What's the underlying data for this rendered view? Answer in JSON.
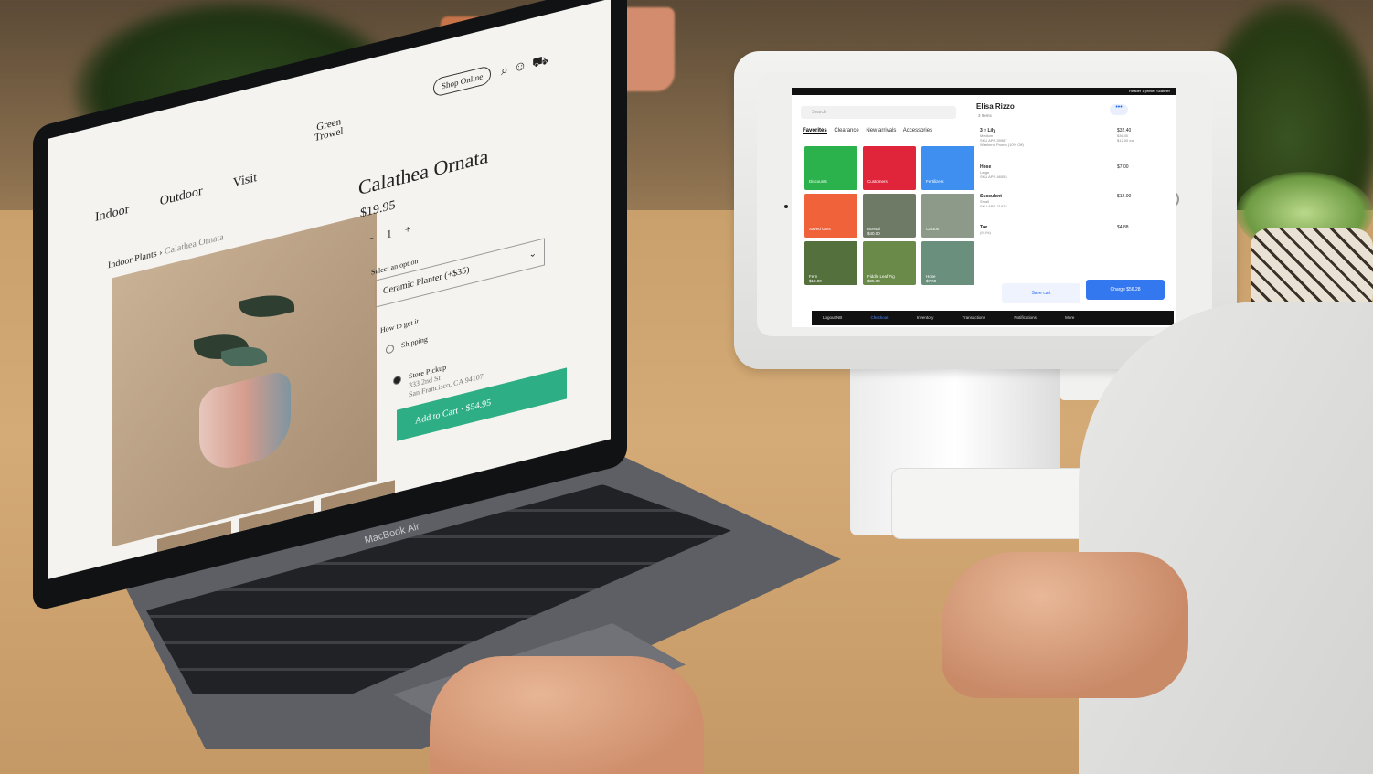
{
  "laptop": {
    "brand": "MacBook Air",
    "nav": [
      "Indoor",
      "Outdoor",
      "Visit"
    ],
    "logo": [
      "Green",
      "Trowel"
    ],
    "shop_button": "Shop Online",
    "icons": [
      "search-icon",
      "account-icon",
      "cart-icon"
    ],
    "breadcrumb": {
      "parent": "Indoor Plants",
      "current": "Calathea Ornata"
    },
    "product": {
      "title": "Calathea Ornata",
      "price": "$19.95",
      "qty_minus": "−",
      "qty_value": "1",
      "qty_plus": "+",
      "option_label": "Select an option",
      "option_value": "Ceramic Planter (+$35)",
      "get_label": "How to get it",
      "shipping": "Shipping",
      "pickup_title": "Store Pickup",
      "pickup_line1": "333 2nd St",
      "pickup_line2": "San Francisco, CA 94107",
      "add_to_cart": "Add to Cart",
      "add_to_cart_price": "$54.95"
    }
  },
  "tablet": {
    "status": "Reader  1 printer  Scanner",
    "search_placeholder": "Search",
    "tabs": [
      "Favorites",
      "Clearance",
      "New arrivals",
      "Accessories"
    ],
    "tiles": [
      {
        "label": "Discounts",
        "color": "#2bb24c"
      },
      {
        "label": "Customers",
        "color": "#e0253a"
      },
      {
        "label": "Fertilizers",
        "color": "#3e8ff0"
      },
      {
        "label": "Saved carts",
        "color": "#f0623a"
      },
      {
        "label": "Bonsai",
        "price": "$40.00",
        "color": "#6f7a66"
      },
      {
        "label": "Cactus",
        "price": "",
        "color": "#8d9a8a"
      },
      {
        "label": "Fern",
        "price": "$18.00",
        "color": "#54703c"
      },
      {
        "label": "Fiddle Leaf Fig",
        "price": "$25.00",
        "color": "#6a8a4a"
      },
      {
        "label": "Hose",
        "price": "$7.00",
        "color": "#6b8f7d"
      }
    ],
    "customer": "Elisa Rizzo",
    "item_count": "3 Items",
    "more": "•••",
    "cart": [
      {
        "qty": "3 ×",
        "name": "Lily",
        "sub": "Medium",
        "sku": "SKU APP-39987",
        "note": "Weekend Promo (10% Off)",
        "price": "$32.40",
        "old_price": "$36.00",
        "unit": "$12.00 ea"
      },
      {
        "name": "Hose",
        "sub": "Large",
        "sku": "SKU APP-46553",
        "price": "$7.00"
      },
      {
        "name": "Succulent",
        "sub": "Small",
        "sku": "SKU APP-71923",
        "price": "$12.00"
      },
      {
        "name": "Tax",
        "sub": "(9.5%)",
        "price": "$4.88"
      }
    ],
    "save_cart": "Save cart",
    "charge": "Charge $56.28",
    "bottom_nav": [
      "Logout NB",
      "Checkout",
      "Inventory",
      "Transactions",
      "Notifications",
      "More"
    ],
    "accent": "#3478f0"
  }
}
